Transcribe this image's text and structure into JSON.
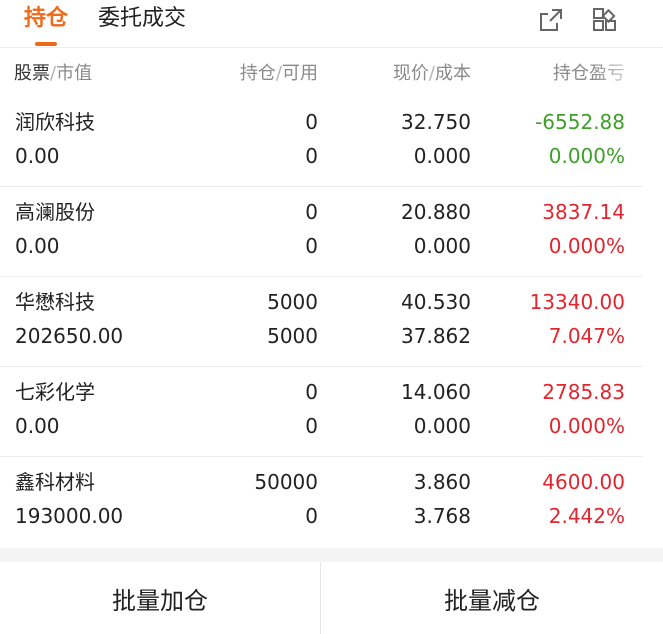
{
  "tabs": [
    {
      "label": "持仓"
    },
    {
      "label": "委托成交"
    }
  ],
  "icons": {
    "share": "share-external-icon",
    "layout": "grid-layout-icon"
  },
  "columns": {
    "stock": "股票",
    "market_value": "市值",
    "holding": "持仓",
    "available": "可用",
    "price": "现价",
    "cost": "成本",
    "pl": "持仓盈亏"
  },
  "separator": "/",
  "colors": {
    "accent": "#ee6a1b",
    "up": "#e0262e",
    "down": "#3e9f2b"
  },
  "rows": [
    {
      "name": "润欣科技",
      "market_value": "0.00",
      "holding": "0",
      "available": "0",
      "price": "32.750",
      "cost": "0.000",
      "pl": "-6552.88",
      "pl_pct": "0.000%",
      "trend": "down"
    },
    {
      "name": "高澜股份",
      "market_value": "0.00",
      "holding": "0",
      "available": "0",
      "price": "20.880",
      "cost": "0.000",
      "pl": "3837.14",
      "pl_pct": "0.000%",
      "trend": "up"
    },
    {
      "name": "华懋科技",
      "market_value": "202650.00",
      "holding": "5000",
      "available": "5000",
      "price": "40.530",
      "cost": "37.862",
      "pl": "13340.00",
      "pl_pct": "7.047%",
      "trend": "up"
    },
    {
      "name": "七彩化学",
      "market_value": "0.00",
      "holding": "0",
      "available": "0",
      "price": "14.060",
      "cost": "0.000",
      "pl": "2785.83",
      "pl_pct": "0.000%",
      "trend": "up"
    },
    {
      "name": "鑫科材料",
      "market_value": "193000.00",
      "holding": "50000",
      "available": "0",
      "price": "3.860",
      "cost": "3.768",
      "pl": "4600.00",
      "pl_pct": "2.442%",
      "trend": "up"
    }
  ],
  "buttons": {
    "batch_add": "批量加仓",
    "batch_reduce": "批量减仓"
  }
}
